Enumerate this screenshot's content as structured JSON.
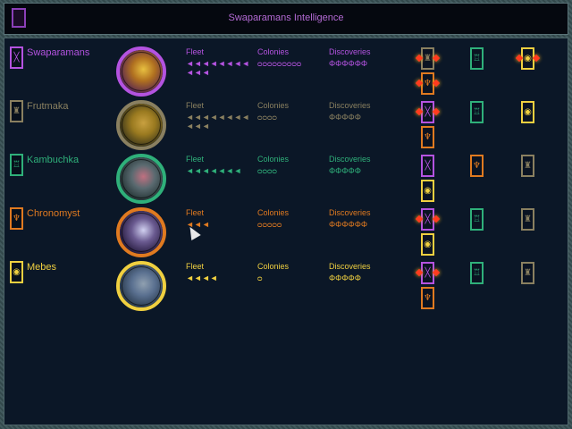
{
  "title": "Swaparamans Intelligence",
  "labels": {
    "fleet": "Fleet",
    "colonies": "Colonies",
    "discoveries": "Discoveries"
  },
  "races": [
    {
      "name": "Swaparamans",
      "color": "#b453e0",
      "icon": "swaparamans-emblem-icon",
      "portrait": [
        "#4a1a5a",
        "#b07020",
        "#e8c040"
      ],
      "fleet": "◄◄◄◄◄◄◄◄◄◄◄",
      "colonies": "ᴑᴑᴑᴑᴑᴑᴑᴑᴑ",
      "discoveries": "ΦΦΦΦΦΦ",
      "diplomacy": [
        {
          "icon": "frutmaka-emblem-icon",
          "color": "#8a8060",
          "flash": true
        },
        {
          "icon": "kambuchka-emblem-icon",
          "color": "#2fb07a",
          "flash": false
        },
        {
          "icon": "mebes-emblem-icon",
          "color": "#f0d040",
          "flash": true
        },
        {
          "icon": "chronomyst-emblem-icon",
          "color": "#e07a20",
          "flash": true
        }
      ]
    },
    {
      "name": "Frutmaka",
      "color": "#8a8060",
      "icon": "frutmaka-emblem-icon",
      "portrait": [
        "#2a2a1a",
        "#9a7a20",
        "#c8a040"
      ],
      "fleet": "◄◄◄◄◄◄◄◄◄◄◄",
      "colonies": "ᴑᴑᴑᴑ",
      "discoveries": "ΦΦΦΦΦ",
      "diplomacy": [
        {
          "icon": "swaparamans-emblem-icon",
          "color": "#b453e0",
          "flash": true
        },
        {
          "icon": "kambuchka-emblem-icon",
          "color": "#2fb07a",
          "flash": false
        },
        {
          "icon": "mebes-emblem-icon",
          "color": "#f0d040",
          "flash": false
        },
        {
          "icon": "chronomyst-emblem-icon",
          "color": "#e07a20",
          "flash": false
        }
      ]
    },
    {
      "name": "Kambuchka",
      "color": "#2fb07a",
      "icon": "kambuchka-emblem-icon",
      "portrait": [
        "#1a2a2a",
        "#5a6a70",
        "#c07080"
      ],
      "fleet": "◄◄◄◄◄◄◄",
      "colonies": "ᴑᴑᴑᴑ",
      "discoveries": "ΦΦΦΦΦ",
      "diplomacy": [
        {
          "icon": "swaparamans-emblem-icon",
          "color": "#b453e0",
          "flash": false
        },
        {
          "icon": "chronomyst-emblem-icon",
          "color": "#e07a20",
          "flash": false
        },
        {
          "icon": "frutmaka-emblem-icon",
          "color": "#8a8060",
          "flash": false
        },
        {
          "icon": "mebes-emblem-icon",
          "color": "#f0d040",
          "flash": false
        }
      ]
    },
    {
      "name": "Chronomyst",
      "color": "#e07a20",
      "icon": "chronomyst-emblem-icon",
      "portrait": [
        "#1a1030",
        "#6a5a90",
        "#d0d0f0"
      ],
      "fleet": "◄◄◄",
      "colonies": "ᴑᴑᴑᴑᴑ",
      "discoveries": "ΦΦΦΦΦΦ",
      "diplomacy": [
        {
          "icon": "swaparamans-emblem-icon",
          "color": "#b453e0",
          "flash": true
        },
        {
          "icon": "kambuchka-emblem-icon",
          "color": "#2fb07a",
          "flash": false
        },
        {
          "icon": "frutmaka-emblem-icon",
          "color": "#8a8060",
          "flash": false
        },
        {
          "icon": "mebes-emblem-icon",
          "color": "#f0d040",
          "flash": false
        }
      ]
    },
    {
      "name": "Mebes",
      "color": "#f0d040",
      "icon": "mebes-emblem-icon",
      "portrait": [
        "#203040",
        "#5a7090",
        "#90a0b0"
      ],
      "fleet": "◄◄◄◄",
      "colonies": "ᴑ",
      "discoveries": "ΦΦΦΦΦ",
      "diplomacy": [
        {
          "icon": "swaparamans-emblem-icon",
          "color": "#b453e0",
          "flash": true
        },
        {
          "icon": "kambuchka-emblem-icon",
          "color": "#2fb07a",
          "flash": false
        },
        {
          "icon": "frutmaka-emblem-icon",
          "color": "#8a8060",
          "flash": false
        },
        {
          "icon": "chronomyst-emblem-icon",
          "color": "#e07a20",
          "flash": false
        }
      ]
    }
  ]
}
